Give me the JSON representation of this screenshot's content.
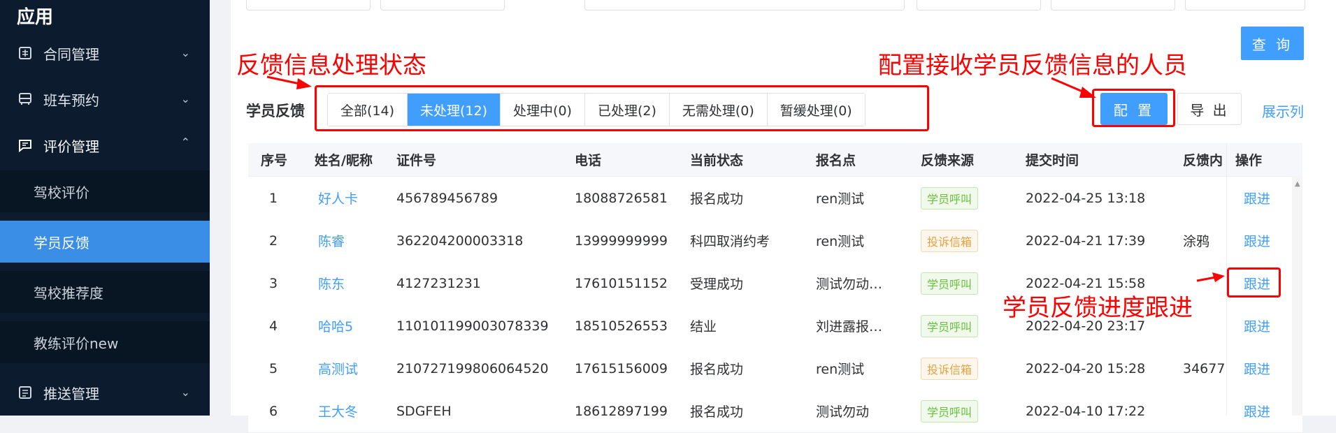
{
  "sidebar": {
    "title": "应用",
    "items": [
      {
        "label": "合同管理",
        "icon": "contract-icon"
      },
      {
        "label": "班车预约",
        "icon": "bus-icon"
      },
      {
        "label": "评价管理",
        "icon": "comment-icon"
      },
      {
        "label": "推送管理",
        "icon": "push-icon"
      }
    ],
    "sub_items": [
      "驾校评价",
      "学员反馈",
      "驾校推荐度",
      "教练评价new"
    ],
    "active_sub": "学员反馈"
  },
  "toolbar": {
    "query_label": "查 询",
    "config_label": "配 置",
    "export_label": "导 出",
    "columns_label": "展示列"
  },
  "section": {
    "title": "学员反馈"
  },
  "tabs": [
    {
      "label": "全部(14)",
      "active": false
    },
    {
      "label": "未处理(12)",
      "active": true
    },
    {
      "label": "处理中(0)",
      "active": false
    },
    {
      "label": "已处理(2)",
      "active": false
    },
    {
      "label": "无需处理(0)",
      "active": false
    },
    {
      "label": "暂缓处理(0)",
      "active": false
    }
  ],
  "table": {
    "headers": [
      "序号",
      "姓名/昵称",
      "证件号",
      "电话",
      "当前状态",
      "报名点",
      "反馈来源",
      "提交时间",
      "反馈内",
      "操作"
    ],
    "rows": [
      {
        "no": "1",
        "name": "好人卡",
        "id": "456789456789",
        "phone": "18088726581",
        "status": "报名成功",
        "site": "ren测试",
        "source": "学员呼叫",
        "source_type": "green",
        "time": "2022-04-25 13:18",
        "content": "",
        "action": "跟进"
      },
      {
        "no": "2",
        "name": "陈睿",
        "id": "362204200003318",
        "phone": "13999999999",
        "status": "科四取消约考",
        "site": "ren测试",
        "source": "投诉信箱",
        "source_type": "orange",
        "time": "2022-04-21 17:39",
        "content": "涂鸦",
        "action": "跟进"
      },
      {
        "no": "3",
        "name": "陈东",
        "id": "4127231231",
        "phone": "17610151152",
        "status": "受理成功",
        "site": "测试勿动…",
        "source": "学员呼叫",
        "source_type": "green",
        "time": "2022-04-21 15:58",
        "content": "",
        "action": "跟进"
      },
      {
        "no": "4",
        "name": "哈哈5",
        "id": "110101199003078339",
        "phone": "18510526553",
        "status": "结业",
        "site": "刘进露报…",
        "source": "学员呼叫",
        "source_type": "green",
        "time": "2022-04-20 23:17",
        "content": "",
        "action": "跟进"
      },
      {
        "no": "5",
        "name": "高测试",
        "id": "210727199806064520",
        "phone": "17615156009",
        "status": "报名成功",
        "site": "ren测试",
        "source": "投诉信箱",
        "source_type": "orange",
        "time": "2022-04-20 15:28",
        "content": "34677",
        "action": "跟进"
      },
      {
        "no": "6",
        "name": "王大冬",
        "id": "SDGFEH",
        "phone": "18612897199",
        "status": "报名成功",
        "site": "测试勿动",
        "source": "学员呼叫",
        "source_type": "green",
        "time": "2022-04-10 17:22",
        "content": "",
        "action": "跟进"
      }
    ]
  },
  "annotations": {
    "status_note": "反馈信息处理状态",
    "config_note": "配置接收学员反馈信息的人员",
    "follow_note": "学员反馈进度跟进"
  },
  "colors": {
    "primary": "#409eff",
    "sidebar_bg": "#0c1c2e",
    "annotation": "#ff0000"
  }
}
